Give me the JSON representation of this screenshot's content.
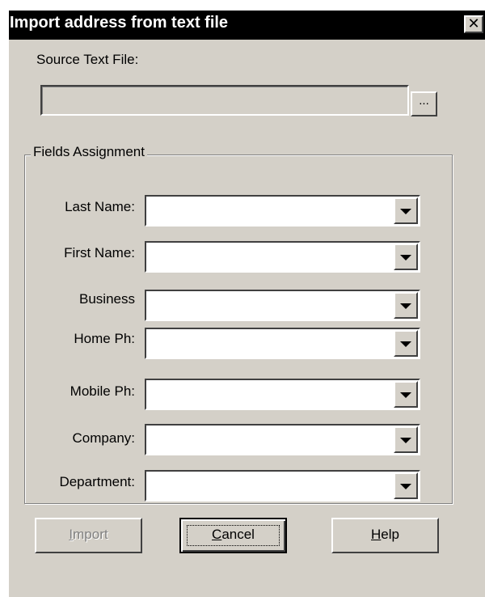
{
  "window": {
    "title": "Import address from text file",
    "close_glyph": "✕"
  },
  "source": {
    "label": "Source Text File:",
    "value": "",
    "browse_label": "..."
  },
  "fields_group": {
    "legend": "Fields Assignment",
    "rows": [
      {
        "label": "Last Name:",
        "value": ""
      },
      {
        "label": "First Name:",
        "value": ""
      },
      {
        "label": "Business",
        "value": ""
      },
      {
        "label": "Home Ph:",
        "value": ""
      },
      {
        "label": "Mobile Ph:",
        "value": ""
      },
      {
        "label": "Company:",
        "value": ""
      },
      {
        "label": "Department:",
        "value": ""
      }
    ]
  },
  "buttons": {
    "import": {
      "mnemonic": "I",
      "rest": "mport",
      "enabled": false
    },
    "cancel": {
      "mnemonic": "C",
      "rest": "ancel"
    },
    "help": {
      "mnemonic": "H",
      "rest": "elp"
    }
  },
  "colors": {
    "dialog_bg": "#d4d0c8",
    "titlebar_bg": "#000000",
    "title_text": "#ffffff",
    "disabled_text": "#808080"
  }
}
